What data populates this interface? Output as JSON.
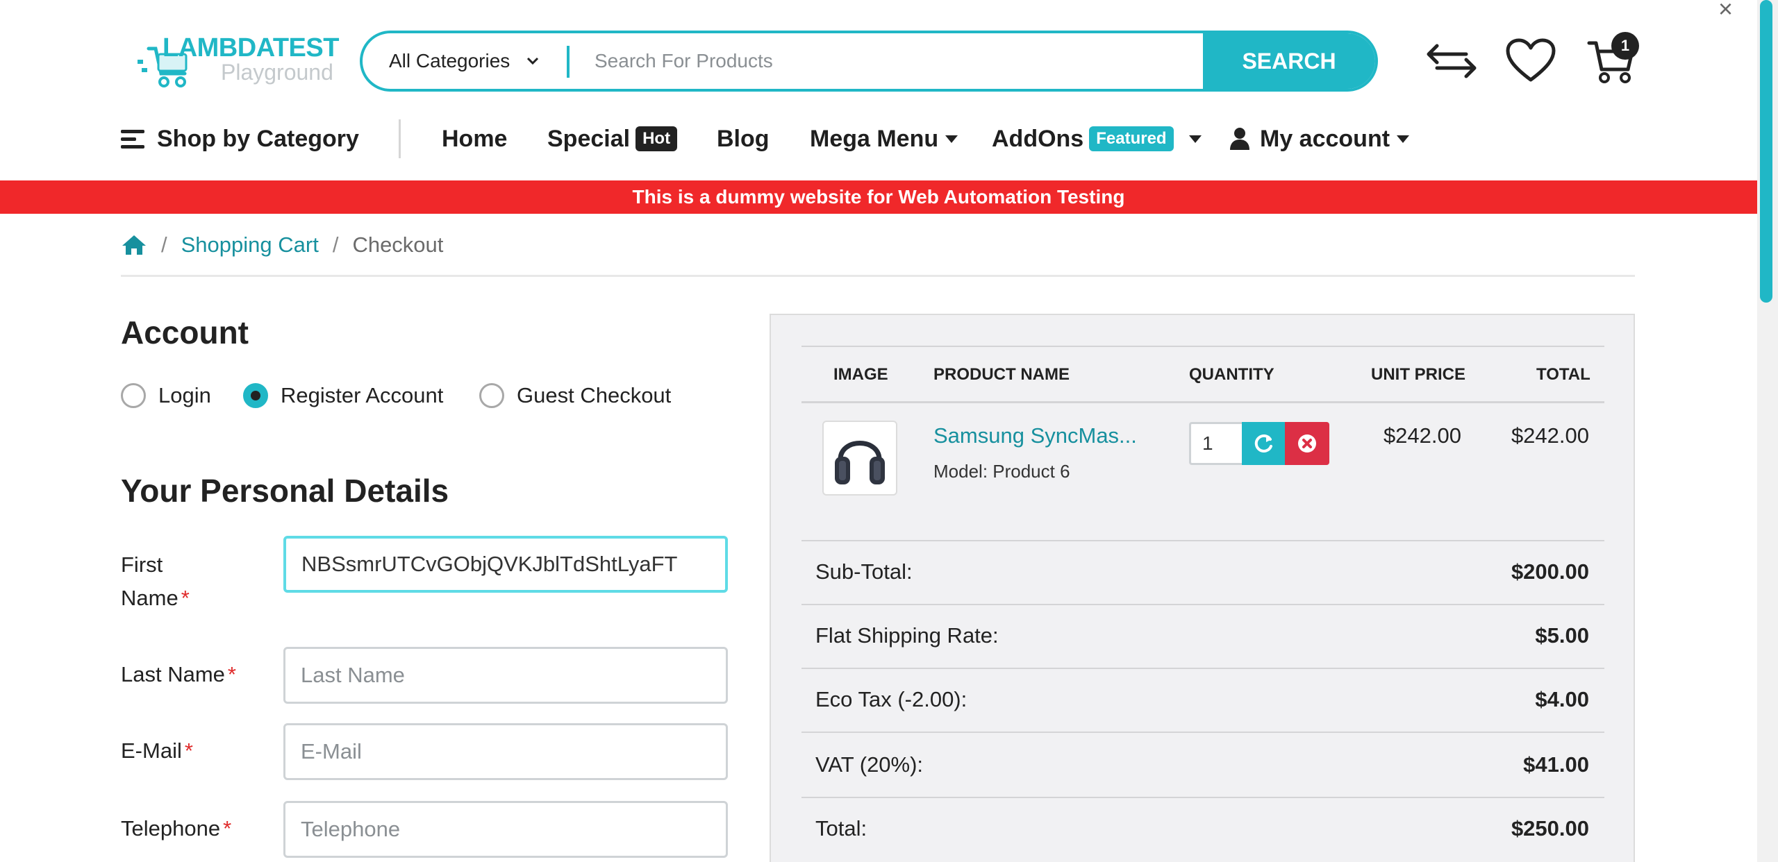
{
  "logo": {
    "brand": "LAMBDATEST",
    "sub": "Playground"
  },
  "search": {
    "category": "All Categories",
    "placeholder": "Search For Products",
    "button": "SEARCH"
  },
  "header_icons": {
    "compare": "compare-arrows-icon",
    "wishlist": "heart-icon",
    "cart": "cart-icon",
    "cart_count": "1"
  },
  "nav": {
    "shop_by_category": "Shop by Category",
    "home": "Home",
    "special": "Special",
    "special_tag": "Hot",
    "blog": "Blog",
    "mega_menu": "Mega Menu",
    "addons": "AddOns",
    "addons_tag": "Featured",
    "my_account": "My account"
  },
  "banner": "This is a dummy website for Web Automation Testing",
  "breadcrumb": {
    "cart": "Shopping Cart",
    "current": "Checkout"
  },
  "account": {
    "heading": "Account",
    "options": [
      "Login",
      "Register Account",
      "Guest Checkout"
    ],
    "selected": "Register Account"
  },
  "personal": {
    "heading": "Your Personal Details",
    "first_name_label_1": "First",
    "first_name_label_2": "Name",
    "first_name_value": "NBSsmrUTCvGObjQVKJblTdShtLyaFT",
    "last_name_label": "Last Name",
    "last_name_placeholder": "Last Name",
    "email_label": "E-Mail",
    "email_placeholder": "E-Mail",
    "telephone_label": "Telephone",
    "telephone_placeholder": "Telephone",
    "required_mark": "*"
  },
  "cart": {
    "columns": [
      "IMAGE",
      "PRODUCT NAME",
      "QUANTITY",
      "UNIT PRICE",
      "TOTAL"
    ],
    "item": {
      "name": "Samsung SyncMas...",
      "model": "Model: Product 6",
      "quantity": "1",
      "unit_price": "$242.00",
      "total": "$242.00"
    },
    "summary": [
      {
        "label": "Sub-Total:",
        "value": "$200.00"
      },
      {
        "label": "Flat Shipping Rate:",
        "value": "$5.00"
      },
      {
        "label": "Eco Tax (-2.00):",
        "value": "$4.00"
      },
      {
        "label": "VAT (20%):",
        "value": "$41.00"
      },
      {
        "label": "Total:",
        "value": "$250.00"
      }
    ]
  },
  "colors": {
    "accent": "#20b7c6",
    "banner": "#f0282a",
    "danger": "#dc2f45",
    "link": "#17909e"
  }
}
